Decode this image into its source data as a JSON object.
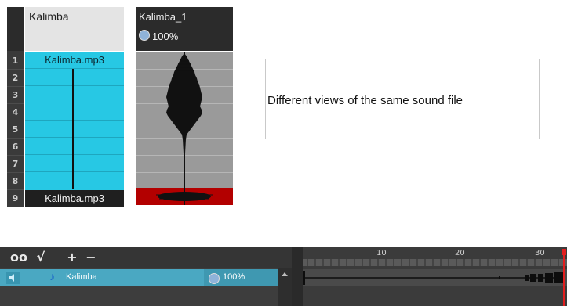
{
  "xsheet_column1": {
    "header": "Kalimba",
    "row_numbers": [
      "1",
      "2",
      "3",
      "4",
      "5",
      "6",
      "7",
      "8",
      "9"
    ],
    "first_cell": "Kalimba.mp3",
    "last_cell": "Kalimba.mp3"
  },
  "xsheet_column2": {
    "header": "Kalimba_1",
    "volume": "100%"
  },
  "caption": "Different views of the same sound file",
  "timeline": {
    "toolbar": [
      "oo",
      "√",
      "+",
      "−"
    ],
    "layer_name": "Kalimba",
    "layer_volume": "100%",
    "ruler_labels": [
      "10",
      "20",
      "30"
    ]
  },
  "colors": {
    "cell_cyan": "#27c8e4",
    "sound_red": "#b30000",
    "timeline_bg": "#3b3b3b",
    "playhead": "#e21e1e"
  }
}
